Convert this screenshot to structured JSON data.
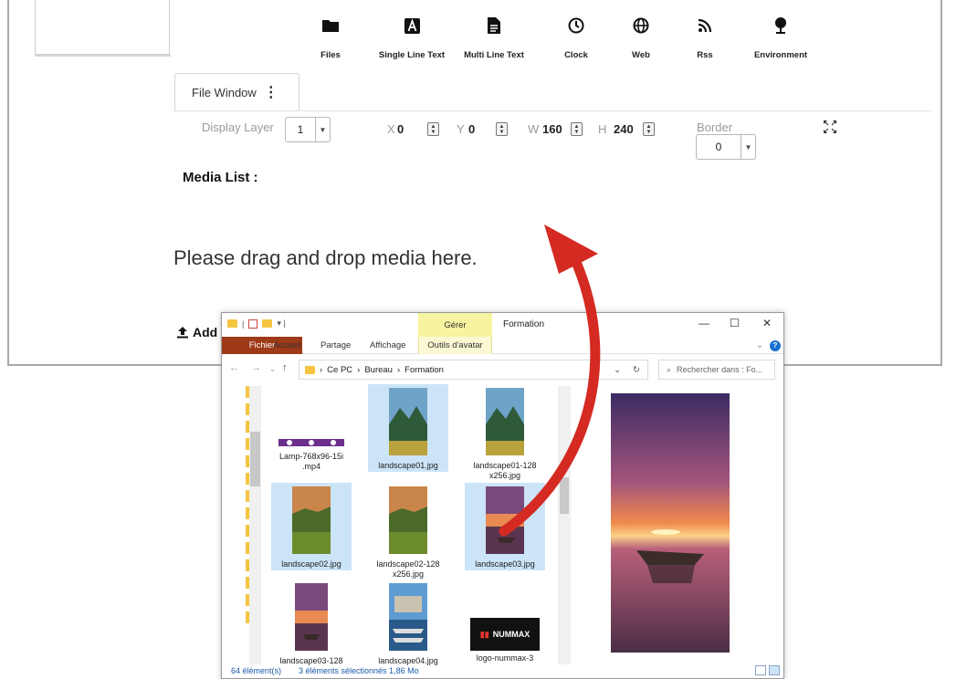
{
  "toolbar": {
    "items": [
      {
        "label": "Files",
        "icon": "folder-icon"
      },
      {
        "label": "Single Line Text",
        "icon": "text-a-icon"
      },
      {
        "label": "Multi Line Text",
        "icon": "document-icon"
      },
      {
        "label": "Clock",
        "icon": "clock-icon"
      },
      {
        "label": "Web",
        "icon": "globe-icon"
      },
      {
        "label": "Rss",
        "icon": "rss-icon"
      },
      {
        "label": "Environment",
        "icon": "tree-icon"
      }
    ]
  },
  "tab": {
    "label": "File Window",
    "menu_icon": "kebab-icon"
  },
  "properties": {
    "display_layer_label": "Display Layer",
    "display_layer_value": "1",
    "x_label": "X",
    "x_value": "0",
    "y_label": "Y",
    "y_value": "0",
    "w_label": "W",
    "w_value": "160",
    "h_label": "H",
    "h_value": "240",
    "border_label": "Border",
    "border_value": "0"
  },
  "media": {
    "title": "Media List :",
    "drop_hint": "Please drag and drop media here.",
    "add_label": "Add"
  },
  "explorer": {
    "context_group": "Gérer",
    "window_title": "Formation",
    "ribbon_tabs": [
      "Fichier",
      "Accueil",
      "Partage",
      "Affichage"
    ],
    "context_tab": "Outils d'avatar",
    "breadcrumb": [
      "Ce PC",
      "Bureau",
      "Formation"
    ],
    "search_placeholder": "Rechercher dans : Fo...",
    "files": [
      {
        "name": "Lamp-768x96-15i .mp4",
        "selected": false
      },
      {
        "name": "landscape01.jpg",
        "selected": true
      },
      {
        "name": "landscape01-128 x256.jpg",
        "selected": false
      },
      {
        "name": "landscape02.jpg",
        "selected": true
      },
      {
        "name": "landscape02-128 x256.jpg",
        "selected": false
      },
      {
        "name": "landscape03.jpg",
        "selected": true
      },
      {
        "name": "landscape03-128",
        "selected": false
      },
      {
        "name": "landscape04.jpg",
        "selected": false
      },
      {
        "name": "logo-nummax-3",
        "selected": false
      }
    ],
    "logo_text": "NUMMAX",
    "status_count": "64 élément(s)",
    "status_selected": "3 éléments sélectionnés  1,86 Mo"
  },
  "colors": {
    "accent_arrow": "#d42a22",
    "selection": "#cce4f7",
    "file_tab": "#9e3a17"
  }
}
